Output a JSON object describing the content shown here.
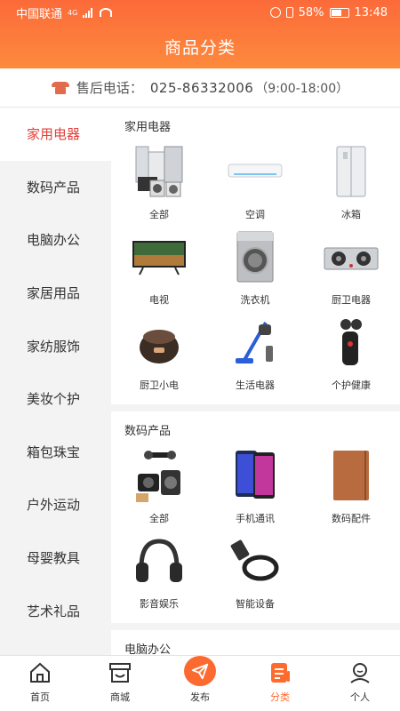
{
  "status_bar": {
    "carrier": "中国联通",
    "network": "4G",
    "battery": "58%",
    "time": "13:48"
  },
  "header": {
    "title": "商品分类"
  },
  "service": {
    "label": "售后电话：",
    "phone": "025-86332006",
    "hours": "（9:00-18:00）"
  },
  "sidebar": {
    "items": [
      "家用电器",
      "数码产品",
      "电脑办公",
      "家居用品",
      "家纺服饰",
      "美妆个护",
      "箱包珠宝",
      "户外运动",
      "母婴教具",
      "艺术礼品"
    ],
    "active_index": 0
  },
  "sections": [
    {
      "title": "家用电器",
      "items": [
        {
          "label": "全部",
          "icon": "appliances-all-icon"
        },
        {
          "label": "空调",
          "icon": "air-conditioner-icon"
        },
        {
          "label": "冰箱",
          "icon": "fridge-icon"
        },
        {
          "label": "电视",
          "icon": "tv-icon"
        },
        {
          "label": "洗衣机",
          "icon": "washing-machine-icon"
        },
        {
          "label": "厨卫电器",
          "icon": "gas-stove-icon"
        },
        {
          "label": "厨卫小电",
          "icon": "rice-cooker-icon"
        },
        {
          "label": "生活电器",
          "icon": "vacuum-icon"
        },
        {
          "label": "个护健康",
          "icon": "shaver-icon"
        }
      ]
    },
    {
      "title": "数码产品",
      "items": [
        {
          "label": "全部",
          "icon": "digital-all-icon"
        },
        {
          "label": "手机通讯",
          "icon": "phone-icon"
        },
        {
          "label": "数码配件",
          "icon": "case-icon"
        },
        {
          "label": "影音娱乐",
          "icon": "headphones-icon"
        },
        {
          "label": "智能设备",
          "icon": "smart-band-icon"
        }
      ]
    },
    {
      "title": "电脑办公",
      "items": []
    }
  ],
  "tabbar": {
    "items": [
      {
        "label": "首页",
        "icon": "home-icon"
      },
      {
        "label": "商城",
        "icon": "store-icon"
      },
      {
        "label": "发布",
        "icon": "paper-plane-icon"
      },
      {
        "label": "分类",
        "icon": "category-icon"
      },
      {
        "label": "个人",
        "icon": "profile-icon"
      }
    ],
    "active_index": 3
  },
  "colors": {
    "accent": "#fd6b2f",
    "active_text": "#e2413a",
    "header_top": "#fc6a3a",
    "header_bottom": "#fd8a3c"
  }
}
